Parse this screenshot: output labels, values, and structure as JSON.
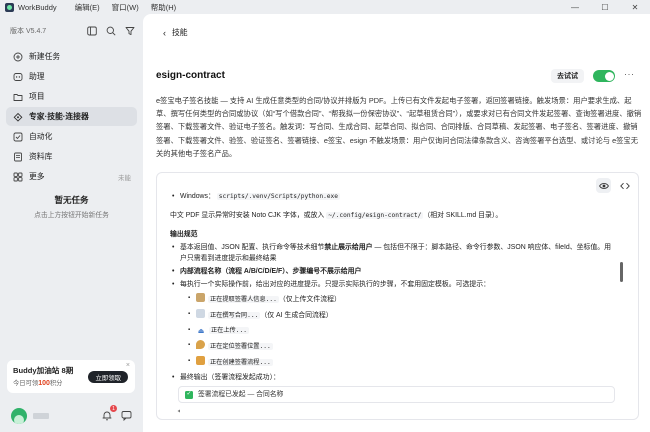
{
  "titlebar": {
    "app_name": "WorkBuddy",
    "menu": [
      "编辑(E)",
      "窗口(W)",
      "帮助(H)"
    ],
    "minimize": "—",
    "maximize": "☐",
    "close": "✕"
  },
  "sidebar": {
    "version": "版本 V5.4.7",
    "nav": [
      {
        "label": "新建任务",
        "icon": "new-task-icon"
      },
      {
        "label": "助理",
        "icon": "assistant-icon"
      },
      {
        "label": "项目",
        "icon": "project-icon"
      },
      {
        "label": "专家·技能·连接器",
        "icon": "expert-skills-icon",
        "active": true
      },
      {
        "label": "自动化",
        "icon": "automation-icon"
      },
      {
        "label": "资料库",
        "icon": "library-icon"
      },
      {
        "label": "更多",
        "icon": "more-icon",
        "extra": "未能"
      }
    ],
    "empty_title": "暂无任务",
    "empty_sub": "点击上方按钮开始新任务",
    "promo": {
      "title": "Buddy加油站 8期",
      "sub_prefix": "今日可领",
      "sub_value": "100",
      "sub_suffix": "积分",
      "button": "立即领取",
      "close": "×"
    },
    "bell_badge": "1"
  },
  "main": {
    "back_label": "技能",
    "title": "esign-contract",
    "try_label": "去试试",
    "toggle_on": true,
    "more": "···",
    "description": "e签宝电子签名技能 — 支持 AI 生成任意类型的合同/协议并排版为 PDF。上传已有文件发起电子签署，返回签署链接。触发场景：用户要求生成、起草、撰写任何类型的合同或协议（如“写个借款合同”、“帮我拟一份保密协议”、“起草租赁合同”），或要求对已有合同文件发起签署、查询签署进度、撤销签署、下载签署文件、验证电子签名。触发词：写合同、生成合同、起草合同、拟合同、合同排版、合同草稿、发起签署、电子签名、签署进度、撤销签署、下载签署文件、验签、验证签名、签署链接、e签宝、esign 不触发场景：用户仅询问合同法律条款含义、咨询签署平台选型、或讨论与 e签宝无关的其他电子签名产品。"
  },
  "doc": {
    "windows_label": "Windows：",
    "windows_code": "scripts/.venv/Scripts/python.exe",
    "font_line_pre": "中文 PDF 显示异常时安装 Noto CJK 字体，或放入 ",
    "font_line_code": "~/.config/esign-contract/",
    "font_line_post": "（相对 SKILL.md 目录）。",
    "output_header": "输出规范",
    "rule1_pre": "基本返回值、JSON 配置、执行命令等技术细节",
    "rule1_bold": "禁止展示给用户",
    "rule1_post": " — 包括但不限于：脚本路径、命令行参数、JSON 响应体、fileId、坐标值。用户只需看到进度提示和最终结果",
    "rule2": "内部流程名称（流程 A/B/C/D/E/F）、步骤编号不展示给用户",
    "rule3": "每执行一个实际操作前，给出对应的进度提示。只提示实际执行的步骤，不套用固定模板。可选提示：",
    "steps": [
      {
        "text": "正在提取签署人信息...",
        "note": "（仅上传文件流程）",
        "icon": "clipboard-icon"
      },
      {
        "text": "正在撰写合同...",
        "note": "（仅 AI 生成合同流程）",
        "icon": "document-icon"
      },
      {
        "text": "正在上传...",
        "note": "",
        "icon": "upload-icon"
      },
      {
        "text": "正在定位签署位置...",
        "note": "",
        "icon": "pin-icon"
      },
      {
        "text": "正在创建签署流程...",
        "note": "",
        "icon": "pen-icon"
      }
    ],
    "final_label": "最终输出（签署流程发起成功）：",
    "final_box": "签署流程已发起 — 合同名称",
    "check": "✓"
  }
}
